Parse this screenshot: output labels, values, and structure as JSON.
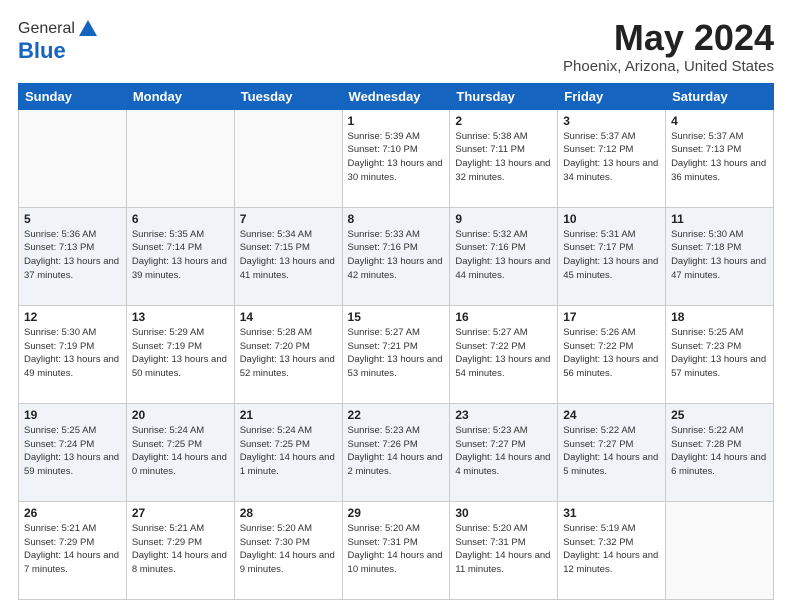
{
  "header": {
    "logo_general": "General",
    "logo_blue": "Blue",
    "title": "May 2024",
    "location": "Phoenix, Arizona, United States"
  },
  "days_of_week": [
    "Sunday",
    "Monday",
    "Tuesday",
    "Wednesday",
    "Thursday",
    "Friday",
    "Saturday"
  ],
  "weeks": [
    [
      {
        "day": "",
        "info": ""
      },
      {
        "day": "",
        "info": ""
      },
      {
        "day": "",
        "info": ""
      },
      {
        "day": "1",
        "info": "Sunrise: 5:39 AM\nSunset: 7:10 PM\nDaylight: 13 hours\nand 30 minutes."
      },
      {
        "day": "2",
        "info": "Sunrise: 5:38 AM\nSunset: 7:11 PM\nDaylight: 13 hours\nand 32 minutes."
      },
      {
        "day": "3",
        "info": "Sunrise: 5:37 AM\nSunset: 7:12 PM\nDaylight: 13 hours\nand 34 minutes."
      },
      {
        "day": "4",
        "info": "Sunrise: 5:37 AM\nSunset: 7:13 PM\nDaylight: 13 hours\nand 36 minutes."
      }
    ],
    [
      {
        "day": "5",
        "info": "Sunrise: 5:36 AM\nSunset: 7:13 PM\nDaylight: 13 hours\nand 37 minutes."
      },
      {
        "day": "6",
        "info": "Sunrise: 5:35 AM\nSunset: 7:14 PM\nDaylight: 13 hours\nand 39 minutes."
      },
      {
        "day": "7",
        "info": "Sunrise: 5:34 AM\nSunset: 7:15 PM\nDaylight: 13 hours\nand 41 minutes."
      },
      {
        "day": "8",
        "info": "Sunrise: 5:33 AM\nSunset: 7:16 PM\nDaylight: 13 hours\nand 42 minutes."
      },
      {
        "day": "9",
        "info": "Sunrise: 5:32 AM\nSunset: 7:16 PM\nDaylight: 13 hours\nand 44 minutes."
      },
      {
        "day": "10",
        "info": "Sunrise: 5:31 AM\nSunset: 7:17 PM\nDaylight: 13 hours\nand 45 minutes."
      },
      {
        "day": "11",
        "info": "Sunrise: 5:30 AM\nSunset: 7:18 PM\nDaylight: 13 hours\nand 47 minutes."
      }
    ],
    [
      {
        "day": "12",
        "info": "Sunrise: 5:30 AM\nSunset: 7:19 PM\nDaylight: 13 hours\nand 49 minutes."
      },
      {
        "day": "13",
        "info": "Sunrise: 5:29 AM\nSunset: 7:19 PM\nDaylight: 13 hours\nand 50 minutes."
      },
      {
        "day": "14",
        "info": "Sunrise: 5:28 AM\nSunset: 7:20 PM\nDaylight: 13 hours\nand 52 minutes."
      },
      {
        "day": "15",
        "info": "Sunrise: 5:27 AM\nSunset: 7:21 PM\nDaylight: 13 hours\nand 53 minutes."
      },
      {
        "day": "16",
        "info": "Sunrise: 5:27 AM\nSunset: 7:22 PM\nDaylight: 13 hours\nand 54 minutes."
      },
      {
        "day": "17",
        "info": "Sunrise: 5:26 AM\nSunset: 7:22 PM\nDaylight: 13 hours\nand 56 minutes."
      },
      {
        "day": "18",
        "info": "Sunrise: 5:25 AM\nSunset: 7:23 PM\nDaylight: 13 hours\nand 57 minutes."
      }
    ],
    [
      {
        "day": "19",
        "info": "Sunrise: 5:25 AM\nSunset: 7:24 PM\nDaylight: 13 hours\nand 59 minutes."
      },
      {
        "day": "20",
        "info": "Sunrise: 5:24 AM\nSunset: 7:25 PM\nDaylight: 14 hours\nand 0 minutes."
      },
      {
        "day": "21",
        "info": "Sunrise: 5:24 AM\nSunset: 7:25 PM\nDaylight: 14 hours\nand 1 minute."
      },
      {
        "day": "22",
        "info": "Sunrise: 5:23 AM\nSunset: 7:26 PM\nDaylight: 14 hours\nand 2 minutes."
      },
      {
        "day": "23",
        "info": "Sunrise: 5:23 AM\nSunset: 7:27 PM\nDaylight: 14 hours\nand 4 minutes."
      },
      {
        "day": "24",
        "info": "Sunrise: 5:22 AM\nSunset: 7:27 PM\nDaylight: 14 hours\nand 5 minutes."
      },
      {
        "day": "25",
        "info": "Sunrise: 5:22 AM\nSunset: 7:28 PM\nDaylight: 14 hours\nand 6 minutes."
      }
    ],
    [
      {
        "day": "26",
        "info": "Sunrise: 5:21 AM\nSunset: 7:29 PM\nDaylight: 14 hours\nand 7 minutes."
      },
      {
        "day": "27",
        "info": "Sunrise: 5:21 AM\nSunset: 7:29 PM\nDaylight: 14 hours\nand 8 minutes."
      },
      {
        "day": "28",
        "info": "Sunrise: 5:20 AM\nSunset: 7:30 PM\nDaylight: 14 hours\nand 9 minutes."
      },
      {
        "day": "29",
        "info": "Sunrise: 5:20 AM\nSunset: 7:31 PM\nDaylight: 14 hours\nand 10 minutes."
      },
      {
        "day": "30",
        "info": "Sunrise: 5:20 AM\nSunset: 7:31 PM\nDaylight: 14 hours\nand 11 minutes."
      },
      {
        "day": "31",
        "info": "Sunrise: 5:19 AM\nSunset: 7:32 PM\nDaylight: 14 hours\nand 12 minutes."
      },
      {
        "day": "",
        "info": ""
      }
    ]
  ]
}
